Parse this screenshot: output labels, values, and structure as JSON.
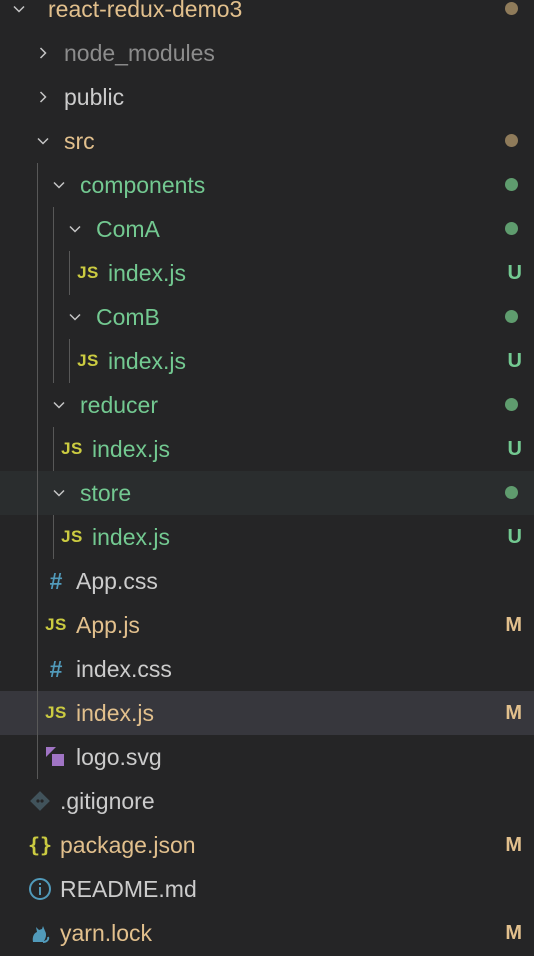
{
  "colors": {
    "untracked": "#73c991",
    "modified": "#e2c08d",
    "ignored": "#8c8c8c",
    "js_icon": "#cbcb41",
    "css_icon": "#519aba",
    "svg_icon": "#a074c4",
    "dot_untracked": "#5f9c6e",
    "dot_modified": "#8f7b5a"
  },
  "explorer": {
    "root": {
      "label": "react-redux-demo3",
      "expanded": true,
      "status_dot": "modified"
    },
    "node_modules": {
      "label": "node_modules",
      "expanded": false
    },
    "public": {
      "label": "public",
      "expanded": false
    },
    "src": {
      "label": "src",
      "expanded": true,
      "status_dot": "modified"
    },
    "components": {
      "label": "components",
      "expanded": true,
      "status_dot": "untracked"
    },
    "comA": {
      "label": "ComA",
      "expanded": true,
      "status_dot": "untracked"
    },
    "comA_index": {
      "label": "index.js",
      "icon": "js-icon",
      "badge": "U"
    },
    "comB": {
      "label": "ComB",
      "expanded": true,
      "status_dot": "untracked"
    },
    "comB_index": {
      "label": "index.js",
      "icon": "js-icon",
      "badge": "U"
    },
    "reducer": {
      "label": "reducer",
      "expanded": true,
      "status_dot": "untracked"
    },
    "reducer_index": {
      "label": "index.js",
      "icon": "js-icon",
      "badge": "U"
    },
    "store": {
      "label": "store",
      "expanded": true,
      "status_dot": "untracked"
    },
    "store_index": {
      "label": "index.js",
      "icon": "js-icon",
      "badge": "U"
    },
    "app_css": {
      "label": "App.css",
      "icon": "css-icon"
    },
    "app_js": {
      "label": "App.js",
      "icon": "js-icon",
      "badge": "M"
    },
    "index_css": {
      "label": "index.css",
      "icon": "css-icon"
    },
    "index_js": {
      "label": "index.js",
      "icon": "js-icon",
      "badge": "M"
    },
    "logo_svg": {
      "label": "logo.svg",
      "icon": "svg-icon"
    },
    "gitignore": {
      "label": ".gitignore",
      "icon": "git-icon"
    },
    "package_json": {
      "label": "package.json",
      "icon": "json-icon",
      "badge": "M"
    },
    "readme": {
      "label": "README.md",
      "icon": "info-icon"
    },
    "yarn_lock": {
      "label": "yarn.lock",
      "icon": "yarn-icon",
      "badge": "M"
    }
  }
}
